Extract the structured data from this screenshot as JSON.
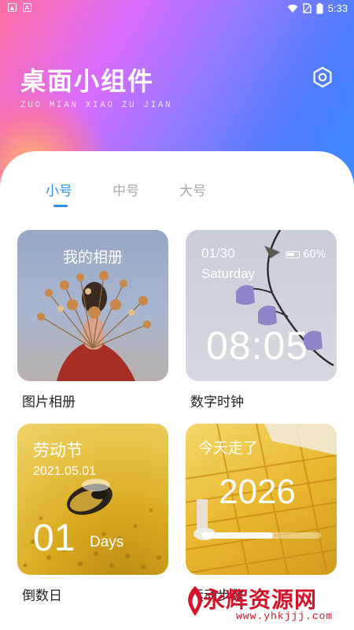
{
  "status_bar": {
    "time": "5:33",
    "left_icons": [
      "image-icon",
      "a-icon"
    ]
  },
  "header": {
    "title": "桌面小组件",
    "subtitle": "ZUO MIAN XIAO ZU JIAN",
    "settings_icon": "settings-hexagon-icon"
  },
  "tabs": [
    {
      "label": "小号",
      "active": true
    },
    {
      "label": "中号",
      "active": false
    },
    {
      "label": "大号",
      "active": false
    }
  ],
  "widgets": {
    "album": {
      "title": "我的相册",
      "label": "图片相册"
    },
    "clock": {
      "date": "01/30",
      "day": "Saturday",
      "battery": "60%",
      "time": "08:05",
      "label": "数字时钟"
    },
    "countdown": {
      "title": "劳动节",
      "date": "2021.05.01",
      "days": "01",
      "unit": "Days",
      "label": "倒数日"
    },
    "steps": {
      "title": "今天走了",
      "count": "2026",
      "progress": 0.6,
      "label": "运动步数"
    }
  },
  "watermark": {
    "text": "永辉资源网",
    "url": "www.yhkjjj.com"
  },
  "colors": {
    "accent": "#2d8cf0",
    "watermark": "#d3132a"
  }
}
